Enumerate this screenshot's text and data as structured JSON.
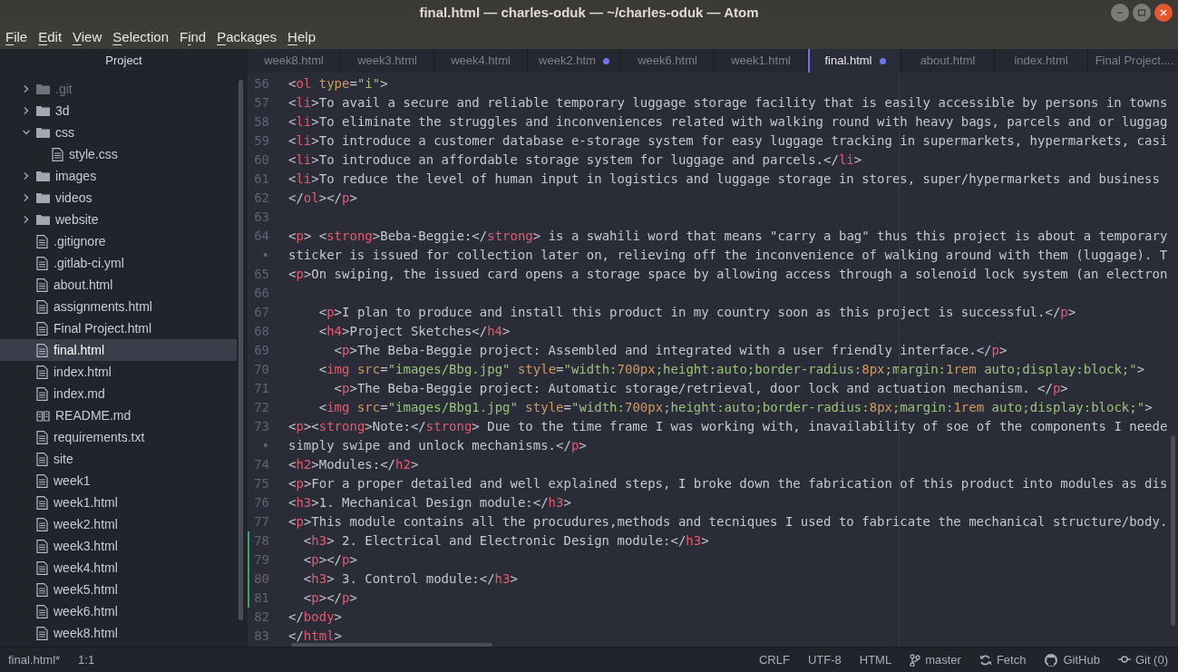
{
  "window": {
    "title": "final.html — charles-oduk — ~/charles-oduk — Atom"
  },
  "menu": [
    {
      "key": "F",
      "post": "ile"
    },
    {
      "key": "E",
      "post": "dit"
    },
    {
      "key": "V",
      "post": "iew"
    },
    {
      "key": "S",
      "post": "election"
    },
    {
      "pre": "F",
      "key": "i",
      "post": "nd"
    },
    {
      "key": "P",
      "post": "ackages"
    },
    {
      "key": "H",
      "post": "elp"
    }
  ],
  "sidebar": {
    "title": "Project",
    "tree": [
      {
        "label": ".git",
        "kind": "folder",
        "expanded": false,
        "ignored": true,
        "selected": false
      },
      {
        "label": "3d",
        "kind": "folder",
        "expanded": false,
        "ignored": false,
        "selected": false
      },
      {
        "label": "css",
        "kind": "folder",
        "expanded": true,
        "ignored": false,
        "selected": false,
        "children": [
          {
            "label": "style.css",
            "kind": "file",
            "ignored": false,
            "selected": false
          }
        ]
      },
      {
        "label": "images",
        "kind": "folder",
        "expanded": false,
        "ignored": false,
        "selected": false
      },
      {
        "label": "videos",
        "kind": "folder",
        "expanded": false,
        "ignored": false,
        "selected": false
      },
      {
        "label": "website",
        "kind": "folder",
        "expanded": false,
        "ignored": false,
        "selected": false
      },
      {
        "label": ".gitignore",
        "kind": "file",
        "ignored": false,
        "selected": false
      },
      {
        "label": ".gitlab-ci.yml",
        "kind": "file",
        "ignored": false,
        "selected": false
      },
      {
        "label": "about.html",
        "kind": "file",
        "ignored": false,
        "selected": false
      },
      {
        "label": "assignments.html",
        "kind": "file",
        "ignored": false,
        "selected": false
      },
      {
        "label": "Final Project.html",
        "kind": "file",
        "ignored": false,
        "selected": false
      },
      {
        "label": "final.html",
        "kind": "file",
        "ignored": false,
        "selected": true
      },
      {
        "label": "index.html",
        "kind": "file",
        "ignored": false,
        "selected": false
      },
      {
        "label": "index.md",
        "kind": "file",
        "ignored": false,
        "selected": false
      },
      {
        "label": "README.md",
        "kind": "book",
        "ignored": false,
        "selected": false
      },
      {
        "label": "requirements.txt",
        "kind": "file",
        "ignored": false,
        "selected": false
      },
      {
        "label": "site",
        "kind": "file",
        "ignored": false,
        "selected": false
      },
      {
        "label": "week1",
        "kind": "file",
        "ignored": false,
        "selected": false
      },
      {
        "label": "week1.html",
        "kind": "file",
        "ignored": false,
        "selected": false
      },
      {
        "label": "week2.html",
        "kind": "file",
        "ignored": false,
        "selected": false
      },
      {
        "label": "week3.html",
        "kind": "file",
        "ignored": false,
        "selected": false
      },
      {
        "label": "week4.html",
        "kind": "file",
        "ignored": false,
        "selected": false
      },
      {
        "label": "week5.html",
        "kind": "file",
        "ignored": false,
        "selected": false
      },
      {
        "label": "week6.html",
        "kind": "file",
        "ignored": false,
        "selected": false
      },
      {
        "label": "week8.html",
        "kind": "file",
        "ignored": false,
        "selected": false
      }
    ]
  },
  "tabs": [
    {
      "label": "week8.html",
      "selected": false,
      "modified": false
    },
    {
      "label": "week3.html",
      "selected": false,
      "modified": false
    },
    {
      "label": "week4.html",
      "selected": false,
      "modified": false
    },
    {
      "label": "week2.htm",
      "selected": false,
      "modified": true
    },
    {
      "label": "week6.html",
      "selected": false,
      "modified": false
    },
    {
      "label": "week1.html",
      "selected": false,
      "modified": false
    },
    {
      "label": "final.html",
      "selected": true,
      "modified": true
    },
    {
      "label": "about.html",
      "selected": false,
      "modified": false
    },
    {
      "label": "index.html",
      "selected": false,
      "modified": false
    },
    {
      "label": "Final Project....",
      "selected": false,
      "modified": false
    }
  ],
  "editor": {
    "lines": [
      {
        "gutter": "56",
        "text": "<ol type=\"i\">",
        "added": false
      },
      {
        "gutter": "57",
        "text": "<li>To avail a secure and reliable temporary luggage storage facility that is easily accessible by persons in towns",
        "added": false
      },
      {
        "gutter": "58",
        "text": "<li>To eliminate the struggles and inconveniences related with walking round with heavy bags, parcels and or luggag",
        "added": false
      },
      {
        "gutter": "59",
        "text": "<li>To introduce a customer database e-storage system for easy luggage tracking in supermarkets, hypermarkets, casi",
        "added": false
      },
      {
        "gutter": "60",
        "text": "<li>To introduce an affordable storage system for luggage and parcels.</li>",
        "added": false
      },
      {
        "gutter": "61",
        "text": "<li>To reduce the level of human input in logistics and luggage storage in stores, super/hypermarkets and business",
        "added": false
      },
      {
        "gutter": "62",
        "text": "</ol></p>",
        "added": false
      },
      {
        "gutter": "63",
        "added": false
      },
      {
        "gutter": "64",
        "text": "<p> <strong>Beba-Beggie:</strong> is a swahili word that means \"carry a bag\" thus this project is about a temporary",
        "added": false
      },
      {
        "gutter": "•",
        "text": "sticker is issued for collection later on, relieving off the inconvenience of walking around with them (luggage). T",
        "added": false
      },
      {
        "gutter": "65",
        "text": "<p>On swiping, the issued card opens a storage space by allowing access through a solenoid lock system (an electron",
        "added": false
      },
      {
        "gutter": "66",
        "added": false
      },
      {
        "gutter": "67",
        "text": "    <p>I plan to produce and install this product in my country soon as this project is successful.</p>",
        "added": false
      },
      {
        "gutter": "68",
        "text": "    <h4>Project Sketches</h4>",
        "added": false
      },
      {
        "gutter": "69",
        "text": "      <p>The Beba-Beggie project: Assembled and integrated with a user friendly interface.</p>",
        "added": false
      },
      {
        "gutter": "70",
        "text": "    <img src=\"images/Bbg.jpg\" style=\"width:700px;height:auto;border-radius:8px;margin:1rem auto;display:block;\">",
        "added": false
      },
      {
        "gutter": "71",
        "text": "      <p>The Beba-Beggie project: Automatic storage/retrieval, door lock and actuation mechanism. </p>",
        "added": false
      },
      {
        "gutter": "72",
        "text": "    <img src=\"images/Bbg1.jpg\" style=\"width:700px;height:auto;border-radius:8px;margin:1rem auto;display:block;\">",
        "added": false
      },
      {
        "gutter": "73",
        "text": "<p><strong>Note:</strong> Due to the time frame I was working with, inavailability of soe of the components I neede",
        "added": false
      },
      {
        "gutter": "•",
        "text": "simply swipe and unlock mechanisms.</p>",
        "added": false
      },
      {
        "gutter": "74",
        "text": "<h2>Modules:</h2>",
        "added": false
      },
      {
        "gutter": "75",
        "text": "<p>For a proper detailed and well explained steps, I broke down the fabrication of this product into modules as dis",
        "added": false
      },
      {
        "gutter": "76",
        "text": "<h3>1. Mechanical Design module:</h3>",
        "added": false
      },
      {
        "gutter": "77",
        "text": "<p>This module contains all the procudures,methods and tecniques I used to fabricate the mechanical structure/body.",
        "added": false
      },
      {
        "gutter": "78",
        "text": "  <h3> 2. Electrical and Electronic Design module:</h3>",
        "added": true
      },
      {
        "gutter": "79",
        "text": "  <p></p>",
        "added": true
      },
      {
        "gutter": "80",
        "text": "  <h3> 3. Control module:</h3>",
        "added": true
      },
      {
        "gutter": "81",
        "text": "  <p></p>",
        "added": true
      },
      {
        "gutter": "82",
        "text": "</body>",
        "added": false
      },
      {
        "gutter": "83",
        "text": "</html>",
        "added": false
      }
    ]
  },
  "status_bar": {
    "file": "final.html*",
    "cursor": "1:1",
    "items": [
      {
        "label": "CRLF",
        "kind": "text"
      },
      {
        "label": "UTF-8",
        "kind": "text"
      },
      {
        "label": "HTML",
        "kind": "text"
      },
      {
        "label": "master",
        "kind": "branch"
      },
      {
        "label": "Fetch",
        "kind": "fetch"
      },
      {
        "label": "GitHub",
        "kind": "github"
      },
      {
        "label": "Git (0)",
        "kind": "git"
      }
    ]
  }
}
